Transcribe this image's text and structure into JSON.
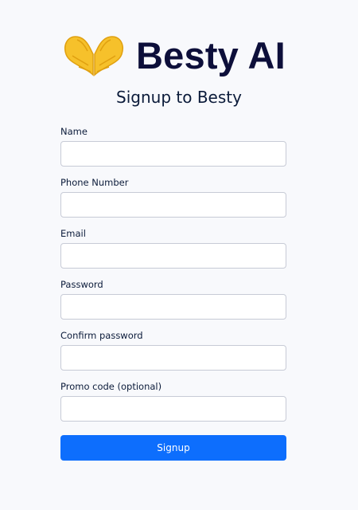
{
  "brand": {
    "icon": "heart-hands-icon",
    "name": "Besty AI"
  },
  "title": "Signup to Besty",
  "form": {
    "fields": [
      {
        "label": "Name",
        "value": ""
      },
      {
        "label": "Phone Number",
        "value": ""
      },
      {
        "label": "Email",
        "value": ""
      },
      {
        "label": "Password",
        "value": ""
      },
      {
        "label": "Confirm password",
        "value": ""
      },
      {
        "label": "Promo code (optional)",
        "value": ""
      }
    ],
    "submit_label": "Signup"
  },
  "colors": {
    "background": "#f8f9fc",
    "primary": "#0d6efd",
    "brand_text": "#0d0f3a"
  }
}
